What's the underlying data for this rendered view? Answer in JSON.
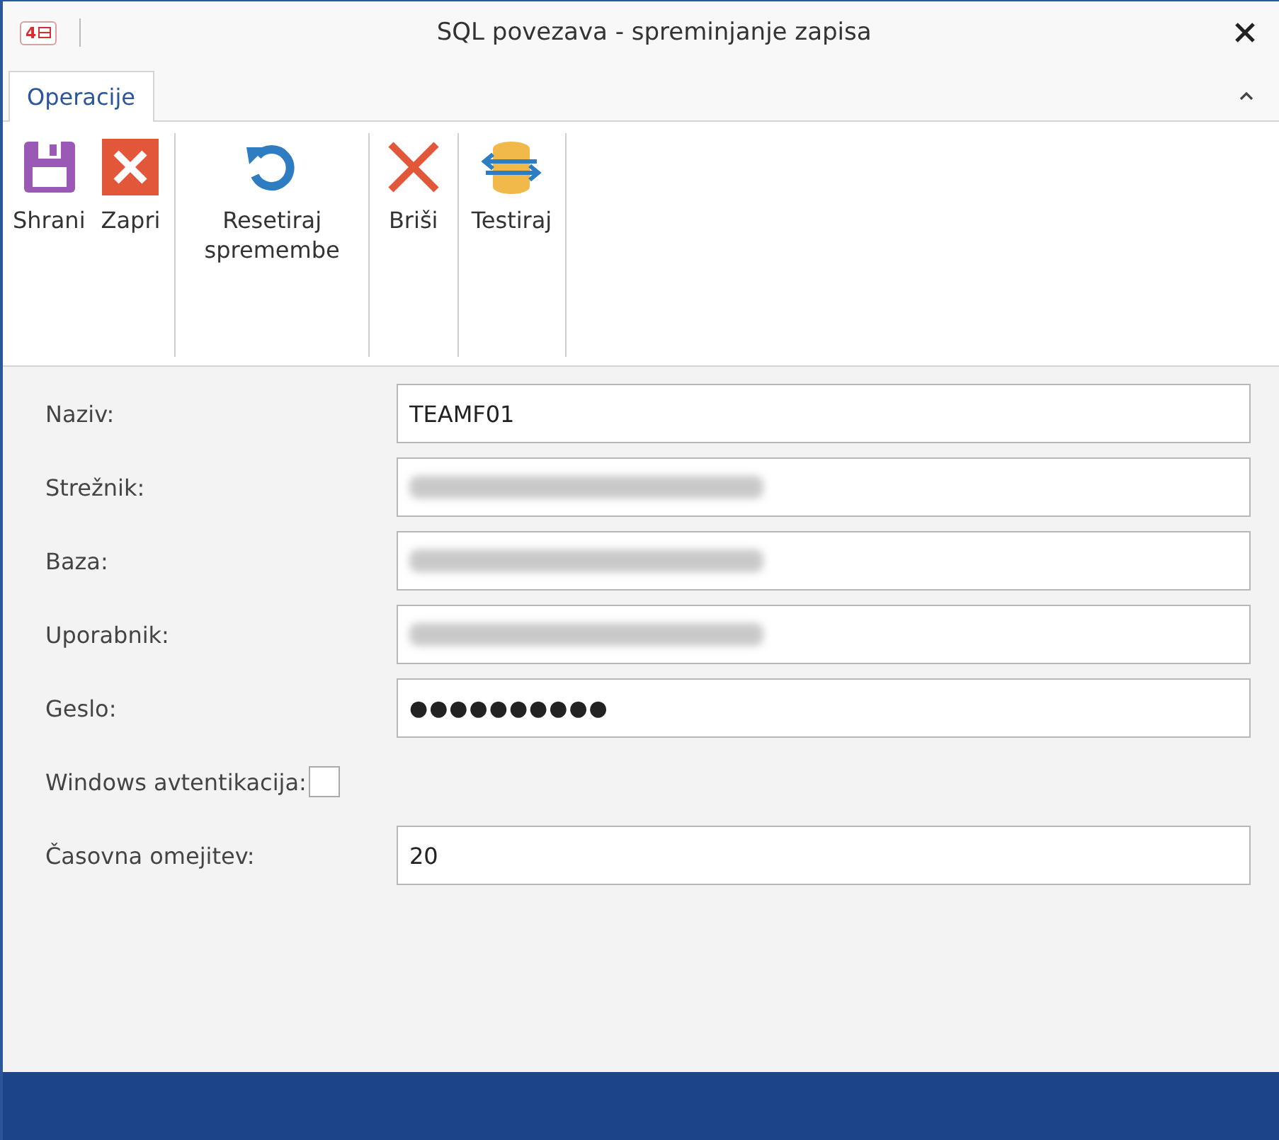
{
  "window": {
    "logo": "4",
    "title": "SQL povezava - spreminjanje zapisa"
  },
  "tabs": [
    {
      "label": "Operacije",
      "selected": true
    }
  ],
  "ribbon_groups": [
    {
      "buttons": [
        {
          "label": "Shrani",
          "kind": "save"
        },
        {
          "label": "Zapri",
          "kind": "close"
        }
      ]
    },
    {
      "buttons": [
        {
          "label": "Resetiraj\nspremembe",
          "kind": "reset"
        }
      ]
    },
    {
      "buttons": [
        {
          "label": "Briši",
          "kind": "delete"
        }
      ]
    },
    {
      "buttons": [
        {
          "label": "Testiraj",
          "kind": "test"
        }
      ]
    }
  ],
  "fields": [
    {
      "label": "Naziv:",
      "kind": "text",
      "value": "TEAMF01"
    },
    {
      "label": "Strežnik:",
      "kind": "redacted"
    },
    {
      "label": "Baza:",
      "kind": "redacted"
    },
    {
      "label": "Uporabnik:",
      "kind": "redacted"
    },
    {
      "label": "Geslo:",
      "kind": "password",
      "value": "●●●●●●●●●●"
    },
    {
      "label": "Windows avtentikacija:",
      "kind": "checkbox",
      "checked": false
    },
    {
      "label": "Časovna omejitev:",
      "kind": "text",
      "value": "20"
    }
  ]
}
